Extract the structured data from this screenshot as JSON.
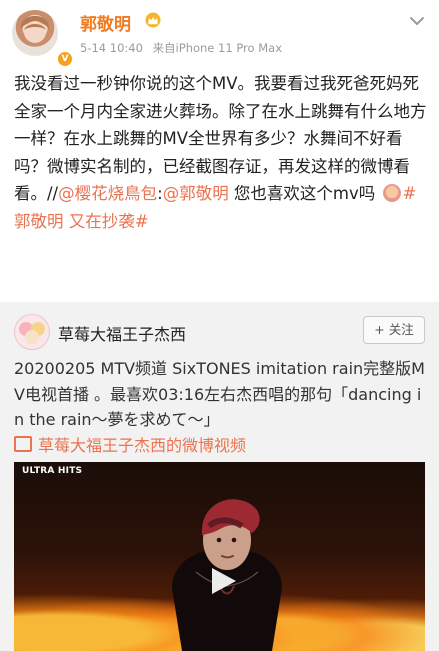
{
  "post": {
    "author": "郭敬明",
    "time": "5-14 10:40",
    "source": "来自iPhone 11 Pro Max",
    "body_parts": [
      {
        "type": "text",
        "value": "我没看过一秒钟你说的这个MV。我要看过我死爸死妈死全家一个月内全家进火葬场。除了在水上跳舞有什么地方一样？在水上跳舞的MV全世界有多少？水舞间不好看吗？微博实名制的，已经截图存证，再发这样的微博看看。//"
      },
      {
        "type": "link",
        "value": "@樱花烧鳥包"
      },
      {
        "type": "text",
        "value": ":"
      },
      {
        "type": "link",
        "value": "@郭敬明"
      },
      {
        "type": "text",
        "value": " 您也喜欢这个mv吗 "
      },
      {
        "type": "emoji",
        "value": ""
      },
      {
        "type": "link",
        "value": "#郭敬明 又在抄袭#"
      }
    ]
  },
  "repost": {
    "author": "草莓大福王子杰西",
    "follow_label": "+ 关注",
    "text": "20200205 MTV频道 SixTONES imitation rain完整版MV电视首播 。最喜欢03:16左右杰西唱的那句「dancing in the rain～夢を求めて～」",
    "video_link": "草莓大福王子杰西的微博视频",
    "video_channel_logo": "ULTRA HITS"
  },
  "colors": {
    "username": "#f07a1f",
    "link": "#eb7350",
    "repost_bg": "#f2f2f2"
  },
  "icons": {
    "chevron": "chevron-down-icon",
    "crown": "crown-icon",
    "play": "play-icon",
    "video": "video-icon"
  }
}
